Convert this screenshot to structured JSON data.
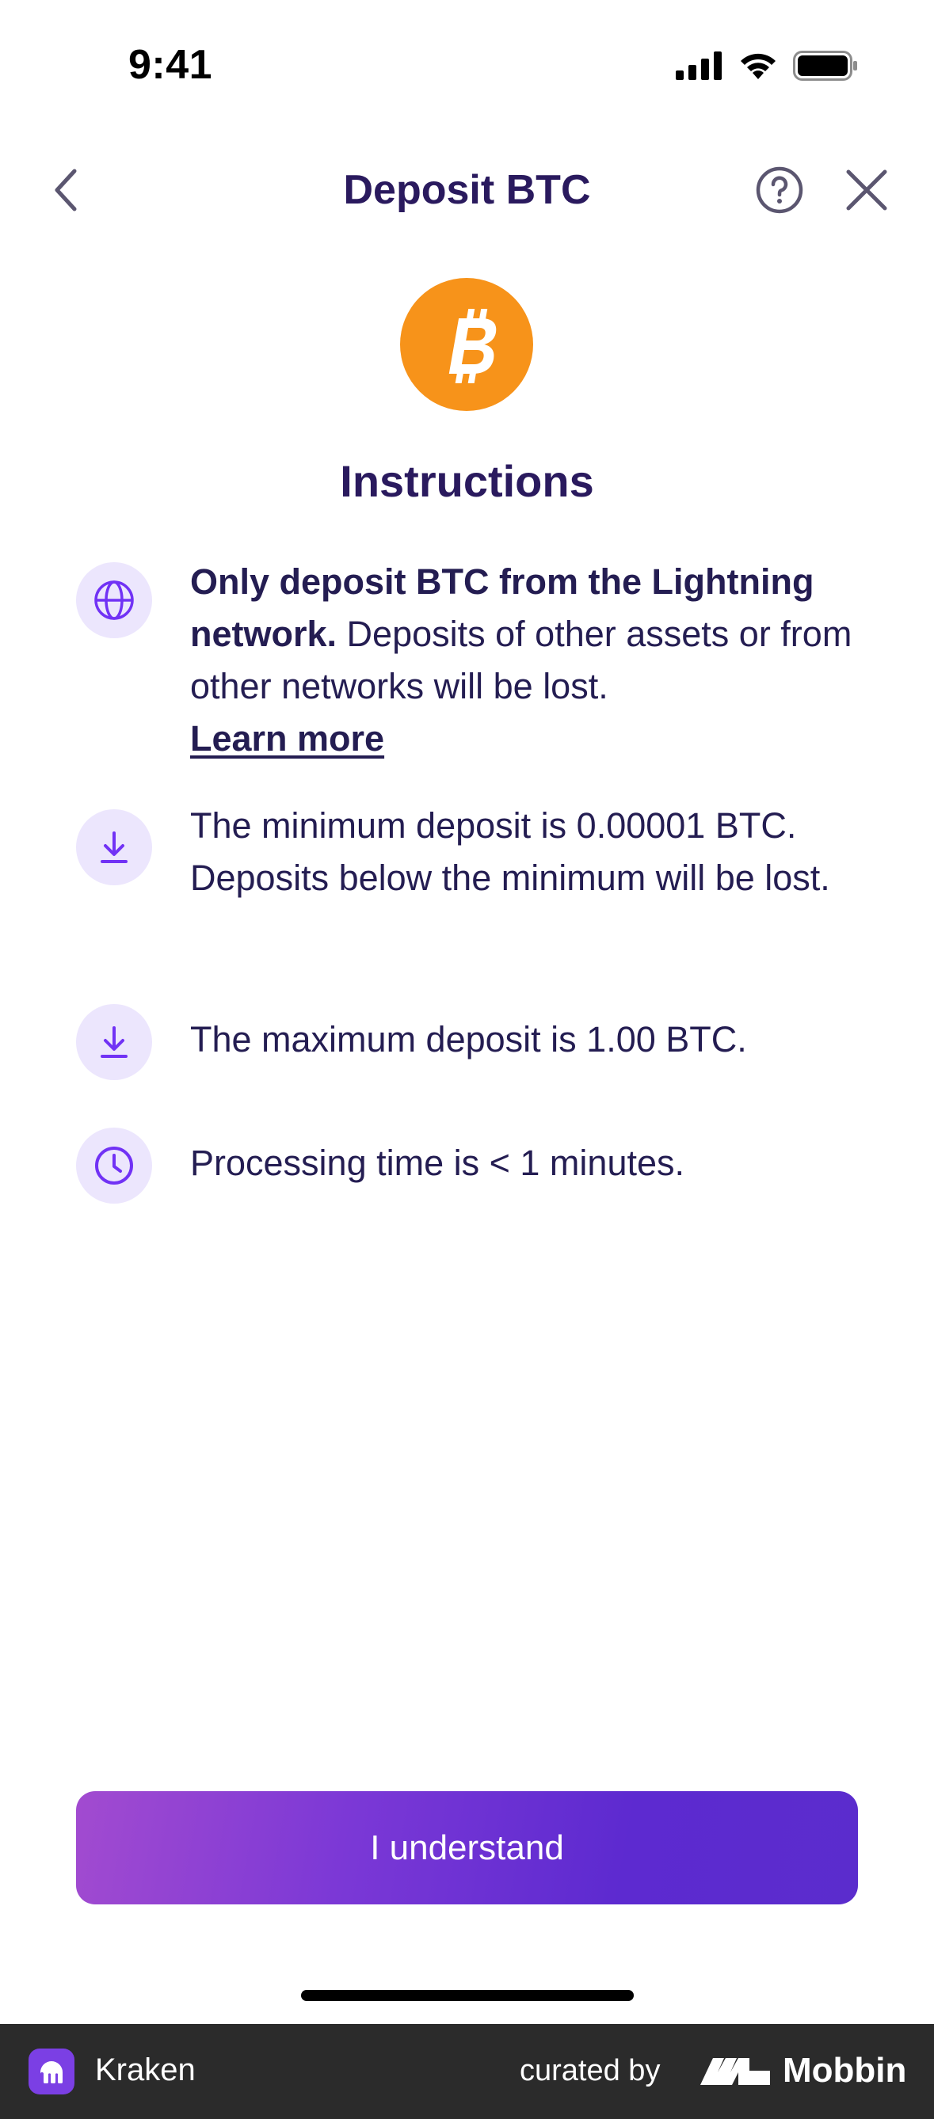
{
  "status_bar": {
    "time": "9:41"
  },
  "header": {
    "title": "Deposit BTC",
    "icons": [
      "chevron-left-icon",
      "help-circle-icon",
      "close-icon"
    ]
  },
  "coin": {
    "icon": "bitcoin-icon",
    "color": "#f7931a"
  },
  "section_title": "Instructions",
  "instructions": [
    {
      "icon": "globe-icon",
      "bold": "Only deposit BTC from the Lightning network.",
      "text": " Deposits of other assets or from other networks will be lost.",
      "link": "Learn more"
    },
    {
      "icon": "download-icon",
      "text": "The minimum deposit is 0.00001 BTC. Deposits below the minimum will be lost."
    },
    {
      "icon": "download-icon",
      "text": "The maximum deposit is 1.00 BTC."
    },
    {
      "icon": "clock-icon",
      "text": "Processing time is < 1 minutes."
    }
  ],
  "primary_button": {
    "label": "I understand"
  },
  "footer": {
    "app_name": "Kraken",
    "curated_by": "curated by",
    "brand": "Mobbin"
  },
  "colors": {
    "accent": "#7132f5",
    "text": "#241d52",
    "icon_bg": "#ece6fd"
  }
}
